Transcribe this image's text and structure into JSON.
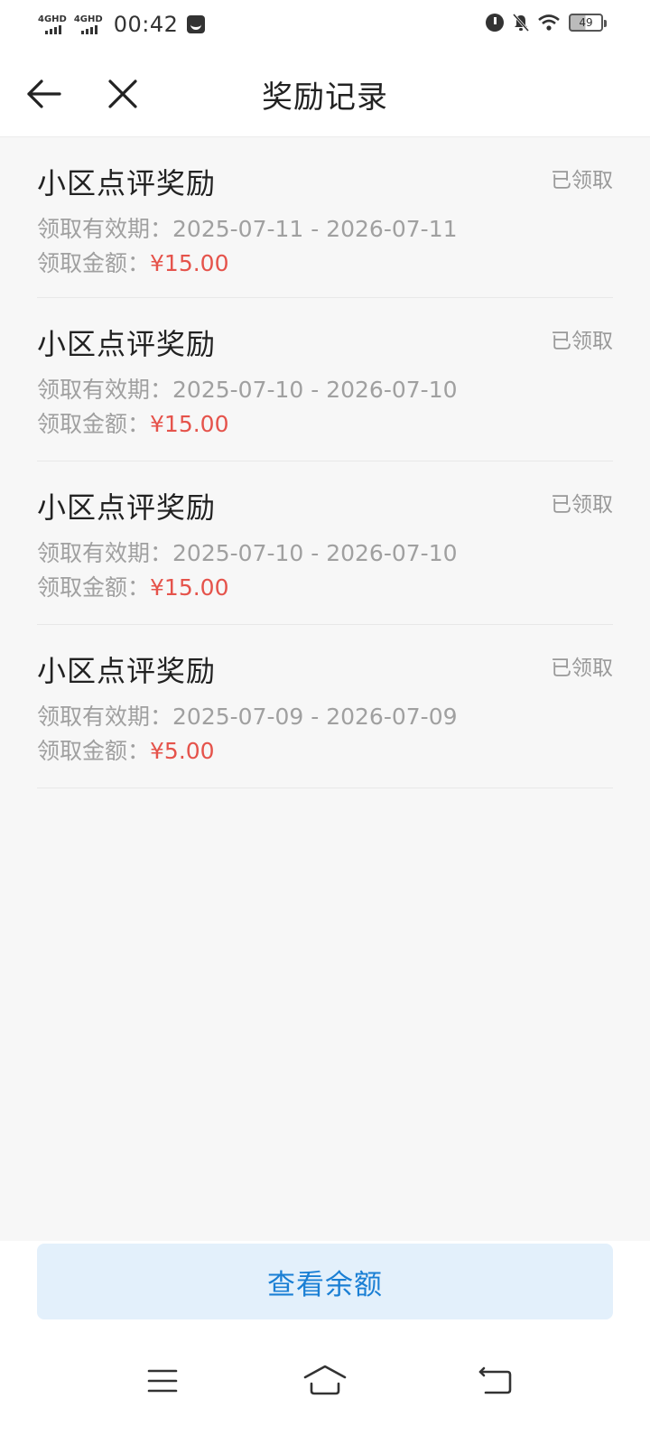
{
  "status_bar": {
    "network_1": "4GHD",
    "network_2": "4GHD",
    "time": "00:42",
    "battery": "49"
  },
  "nav": {
    "title": "奖励记录"
  },
  "records": [
    {
      "title": "小区点评奖励",
      "status": "已领取",
      "validity_label": "领取有效期：",
      "validity": "2025-07-11 - 2026-07-11",
      "amount_label": "领取金额：",
      "amount": "¥15.00"
    },
    {
      "title": "小区点评奖励",
      "status": "已领取",
      "validity_label": "领取有效期：",
      "validity": "2025-07-10 - 2026-07-10",
      "amount_label": "领取金额：",
      "amount": "¥15.00"
    },
    {
      "title": "小区点评奖励",
      "status": "已领取",
      "validity_label": "领取有效期：",
      "validity": "2025-07-10 - 2026-07-10",
      "amount_label": "领取金额：",
      "amount": "¥15.00"
    },
    {
      "title": "小区点评奖励",
      "status": "已领取",
      "validity_label": "领取有效期：",
      "validity": "2025-07-09 - 2026-07-09",
      "amount_label": "领取金额：",
      "amount": "¥5.00"
    }
  ],
  "footer": {
    "balance_button": "查看余额"
  },
  "colors": {
    "amount": "#e5534b",
    "button_bg": "#e3f0fb",
    "button_text": "#1a7fd4"
  },
  "icons": {
    "nav_back": "back-arrow-icon",
    "nav_close": "close-icon",
    "sys_menu": "menu-icon",
    "sys_home": "home-icon",
    "sys_back": "back-icon"
  }
}
